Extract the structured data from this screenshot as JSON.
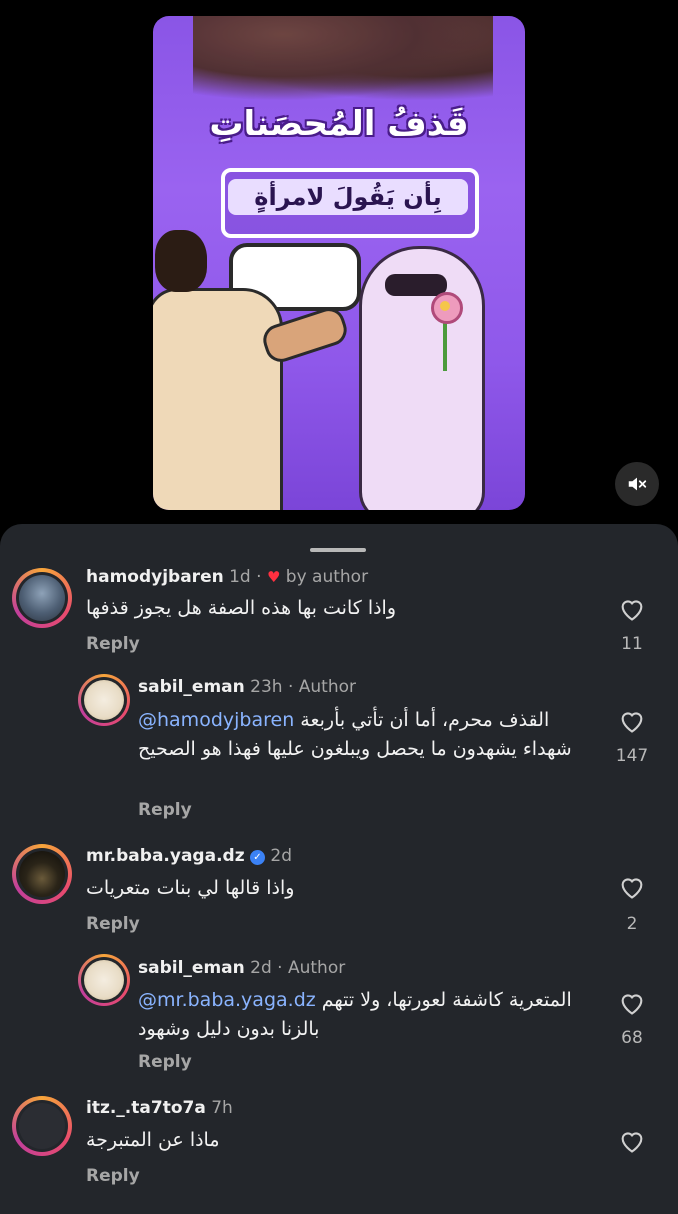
{
  "reel": {
    "title": "قَذفُ المُحصَناتِ",
    "subtitle": "بِأن يَقُولَ لامرأةٍ"
  },
  "comments": [
    {
      "username": "hamodyjbaren",
      "time": "1d",
      "separator": "·",
      "badge": "by author",
      "text": "واذا كانت بها هذه الصفة هل يجوز قذفها",
      "reply_label": "Reply",
      "likes": "11"
    },
    {
      "username": "sabil_eman",
      "time": "23h",
      "separator": "·",
      "author_label": "Author",
      "mention": "@hamodyjbaren",
      "text": "القذف محرم، أما أن تأتي بأربعة شهداء يشهدون ما يحصل ويبلغون عليها فهذا هو الصحيح",
      "reply_label": "Reply",
      "likes": "147"
    },
    {
      "username": "mr.baba.yaga.dz",
      "time": "2d",
      "text": "واذا قالها لي بنات متعريات",
      "reply_label": "Reply",
      "likes": "2"
    },
    {
      "username": "sabil_eman",
      "time": "2d",
      "separator": "·",
      "author_label": "Author",
      "mention": "@mr.baba.yaga.dz",
      "text": "المتعرية كاشفة لعورتها، ولا تتهم بالزنا بدون دليل وشهود",
      "reply_label": "Reply",
      "likes": "68"
    },
    {
      "username": "itz._.ta7to7a",
      "time": "7h",
      "text": "ماذا عن المتبرجة",
      "reply_label": "Reply"
    }
  ],
  "colors": {
    "sheet_bg": "#23262b",
    "accent_heart": "#ff3040",
    "mention": "#8ab4ff",
    "verified": "#3b82f6"
  },
  "icons": [
    "mute-icon",
    "heart-outline-icon",
    "red-heart-icon",
    "verified-badge-icon"
  ]
}
